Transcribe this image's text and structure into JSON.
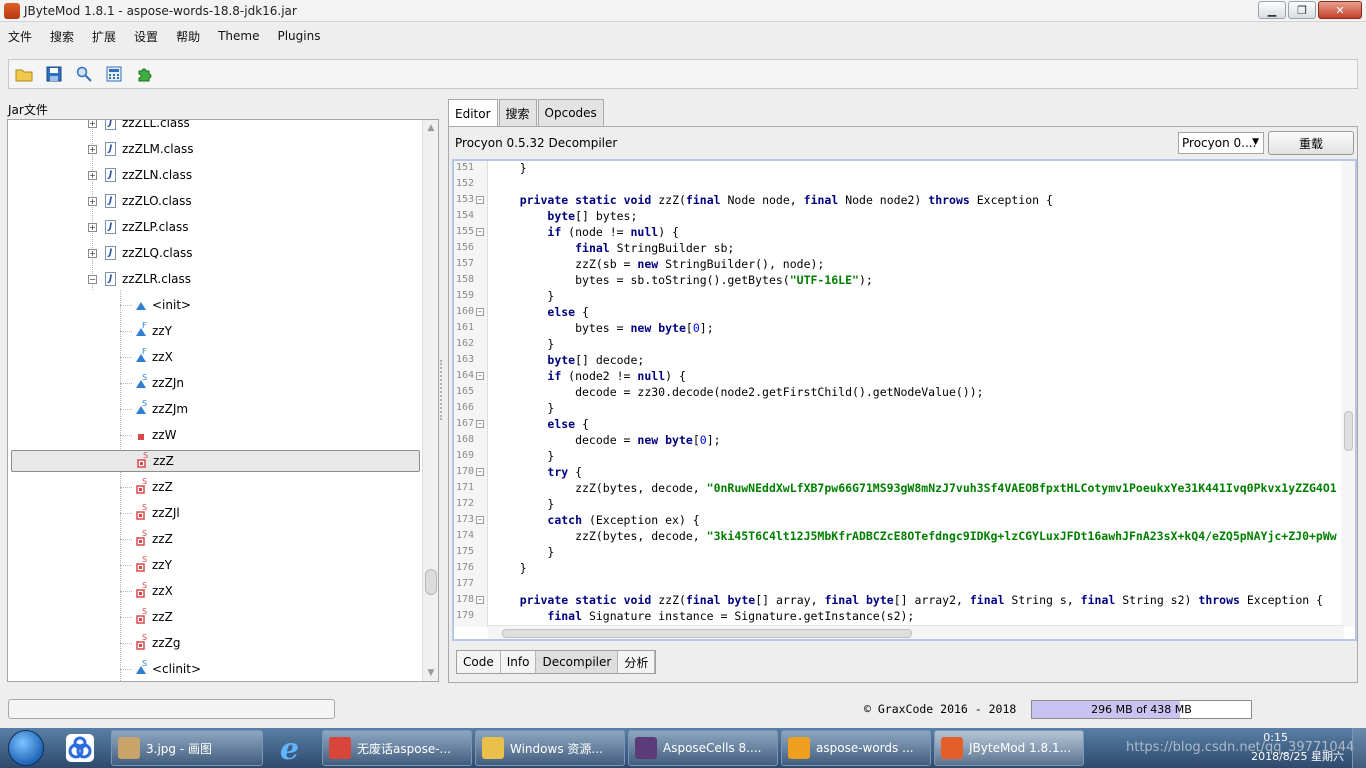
{
  "window": {
    "title": "JByteMod 1.8.1 - aspose-words-18.8-jdk16.jar",
    "min_glyph": "▁",
    "max_glyph": "❐",
    "close_glyph": "✕"
  },
  "menu": [
    "文件",
    "搜索",
    "扩展",
    "设置",
    "帮助",
    "Theme",
    "Plugins"
  ],
  "toolbar": {
    "icons": [
      "open-folder-icon",
      "save-icon",
      "search-icon",
      "calculator-icon",
      "plugin-icon"
    ]
  },
  "left": {
    "label": "Jar文件",
    "tree": [
      {
        "label": "zzZLL.class",
        "kind": "class",
        "expander": "+"
      },
      {
        "label": "zzZLM.class",
        "kind": "class",
        "expander": "+"
      },
      {
        "label": "zzZLN.class",
        "kind": "class",
        "expander": "+"
      },
      {
        "label": "zzZLO.class",
        "kind": "class",
        "expander": "+"
      },
      {
        "label": "zzZLP.class",
        "kind": "class",
        "expander": "+"
      },
      {
        "label": "zzZLQ.class",
        "kind": "class",
        "expander": "+"
      },
      {
        "label": "zzZLR.class",
        "kind": "class",
        "expander": "−"
      },
      {
        "label": "<init>",
        "kind": "public",
        "mark": ""
      },
      {
        "label": "zzY",
        "kind": "public",
        "mark": "F"
      },
      {
        "label": "zzX",
        "kind": "public",
        "mark": "F"
      },
      {
        "label": "zzZJn",
        "kind": "public",
        "mark": "S"
      },
      {
        "label": "zzZJm",
        "kind": "public",
        "mark": "S"
      },
      {
        "label": "zzW",
        "kind": "private-square",
        "mark": ""
      },
      {
        "label": "zzZ",
        "kind": "private",
        "mark": "S",
        "selected": true
      },
      {
        "label": "zzZ",
        "kind": "private",
        "mark": "S"
      },
      {
        "label": "zzZJl",
        "kind": "private",
        "mark": "S"
      },
      {
        "label": "zzZ",
        "kind": "private",
        "mark": "S"
      },
      {
        "label": "zzY",
        "kind": "private",
        "mark": "S"
      },
      {
        "label": "zzX",
        "kind": "private",
        "mark": "S"
      },
      {
        "label": "zzZ",
        "kind": "private",
        "mark": "S"
      },
      {
        "label": "zzZg",
        "kind": "private",
        "mark": "S"
      },
      {
        "label": "<clinit>",
        "kind": "public",
        "mark": "S"
      }
    ]
  },
  "editor": {
    "tabs": [
      "Editor",
      "搜索",
      "Opcodes"
    ],
    "decompiler_label": "Procyon 0.5.32 Decompiler",
    "decompiler_select": "Procyon 0....",
    "reload_label": "重载",
    "code": [
      {
        "n": "151",
        "fold": false,
        "t": "    }"
      },
      {
        "n": "152",
        "fold": false,
        "t": ""
      },
      {
        "n": "153",
        "fold": true,
        "t": "    private static void zzZ(final Node node, final Node node2) throws Exception {"
      },
      {
        "n": "154",
        "fold": false,
        "t": "        byte[] bytes;"
      },
      {
        "n": "155",
        "fold": true,
        "t": "        if (node != null) {"
      },
      {
        "n": "156",
        "fold": false,
        "t": "            final StringBuilder sb;"
      },
      {
        "n": "157",
        "fold": false,
        "t": "            zzZ(sb = new StringBuilder(), node);"
      },
      {
        "n": "158",
        "fold": false,
        "t": "            bytes = sb.toString().getBytes(\"UTF-16LE\");"
      },
      {
        "n": "159",
        "fold": false,
        "t": "        }"
      },
      {
        "n": "160",
        "fold": true,
        "t": "        else {"
      },
      {
        "n": "161",
        "fold": false,
        "t": "            bytes = new byte[0];"
      },
      {
        "n": "162",
        "fold": false,
        "t": "        }"
      },
      {
        "n": "163",
        "fold": false,
        "t": "        byte[] decode;"
      },
      {
        "n": "164",
        "fold": true,
        "t": "        if (node2 != null) {"
      },
      {
        "n": "165",
        "fold": false,
        "t": "            decode = zz30.decode(node2.getFirstChild().getNodeValue());"
      },
      {
        "n": "166",
        "fold": false,
        "t": "        }"
      },
      {
        "n": "167",
        "fold": true,
        "t": "        else {"
      },
      {
        "n": "168",
        "fold": false,
        "t": "            decode = new byte[0];"
      },
      {
        "n": "169",
        "fold": false,
        "t": "        }"
      },
      {
        "n": "170",
        "fold": true,
        "t": "        try {"
      },
      {
        "n": "171",
        "fold": false,
        "t": "            zzZ(bytes, decode, \"0nRuwNEddXwLfXB7pw66G71MS93gW8mNzJ7vuh3Sf4VAEOBfpxtHLCotymv1PoeukxYe31K441Ivq0Pkvx1yZZG4O1"
      },
      {
        "n": "172",
        "fold": false,
        "t": "        }"
      },
      {
        "n": "173",
        "fold": true,
        "t": "        catch (Exception ex) {"
      },
      {
        "n": "174",
        "fold": false,
        "t": "            zzZ(bytes, decode, \"3ki45T6C4lt12J5MbKfrADBCZcE8OTefdngc9IDKg+lzCGYLuxJFDt16awhJFnA23sX+kQ4/eZQ5pNAYjc+ZJ0+pWw"
      },
      {
        "n": "175",
        "fold": false,
        "t": "        }"
      },
      {
        "n": "176",
        "fold": false,
        "t": "    }"
      },
      {
        "n": "177",
        "fold": false,
        "t": ""
      },
      {
        "n": "178",
        "fold": true,
        "t": "    private static void zzZ(final byte[] array, final byte[] array2, final String s, final String s2) throws Exception {"
      },
      {
        "n": "179",
        "fold": false,
        "t": "        final Signature instance = Signature.getInstance(s2);"
      }
    ],
    "bottom_tabs": [
      "Code",
      "Info",
      "Decompiler",
      "分析"
    ]
  },
  "status": {
    "copyright": "© GraxCode 2016 - 2018",
    "memory_text": "296 MB of 438 MB",
    "memory_used_fraction": 0.676
  },
  "taskbar": {
    "items": [
      {
        "label": "3.jpg - 画图",
        "icon": "paint-icon",
        "color": "#c9a36a"
      },
      {
        "label": "无废话aspose-...",
        "icon": "chrome-icon",
        "color": "#d8453a"
      },
      {
        "label": "Windows 资源...",
        "icon": "folder-icon",
        "color": "#e9c14a"
      },
      {
        "label": "AsposeCells 8....",
        "icon": "javaee-ide-icon",
        "color": "#5b3b7a"
      },
      {
        "label": "aspose-words ...",
        "icon": "search-magnifier-icon",
        "color": "#f0a020"
      },
      {
        "label": "JByteMod 1.8.1...",
        "icon": "java-icon",
        "color": "#e45d2b",
        "active": true
      }
    ],
    "watermark": "https://blog.csdn.net/qq_39771044",
    "time": "0:15",
    "date": "2018/8/25 星期六"
  }
}
